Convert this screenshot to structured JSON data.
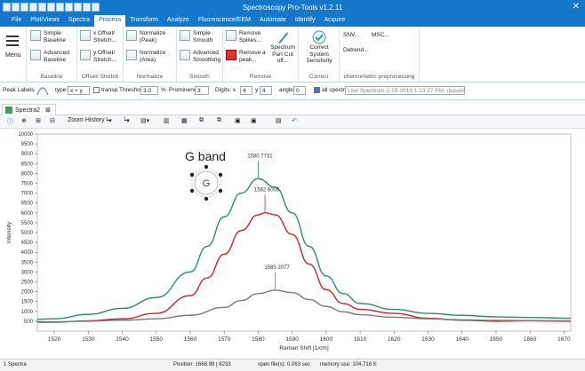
{
  "app": {
    "title": "Spectroscopy Pro-Tools   v1.2.11"
  },
  "menu": [
    "File",
    "Plot/Views",
    "Spectra",
    "Process",
    "Transform",
    "Analyze",
    "Fluorescence/EEM",
    "Automate",
    "Identify",
    "Acquire"
  ],
  "ribbon": {
    "menu_label": "Menu",
    "baseline": {
      "simple": "Simple Baseline",
      "advanced": "Advanced Baseline",
      "label": "Baseline"
    },
    "offset": {
      "x": "x Offset/ Stretch...",
      "y": "y Offset/ Stretch...",
      "label": "Offset/ Stretch"
    },
    "normalize": {
      "peak": "Normalize (Peak)",
      "area": "Normalize (Area)",
      "label": "Normalize"
    },
    "smooth": {
      "simple": "Simple Smooth",
      "advanced": "Advanced Smoothing",
      "label": "Smooth"
    },
    "remove": {
      "spikes": "Remove Spikes...",
      "peak": "Remove a peak...",
      "part": "Spectrum Part Cut off...",
      "label": "Remove"
    },
    "correct": {
      "system": "Correct System Sensitivity",
      "label": "Correct"
    },
    "chemometric": {
      "snv": "SNV...",
      "msc": "MSC...",
      "detrend": "Detrend...",
      "label": "chemometric preprocessing"
    }
  },
  "filterbar": {
    "peak_labels": "Peak Labels",
    "type_label": "type:",
    "type_value": "x + y",
    "transp": "transp.",
    "threshold_label": "Threshold:",
    "threshold_value": "3.0",
    "percent": "%",
    "prominence_label": "Prominence:",
    "prominence_value": "3",
    "digits_label": "Digits: x",
    "digits_x": "4",
    "y_label": "y",
    "digits_y": "4",
    "angle_label": "angle:",
    "angle_value": "0",
    "all_spectra": "all spectra",
    "spectrum_dropdown": "Live Spectrum 2-15-2019 1:13:27 PM, (baselin"
  },
  "tab": {
    "label": "Spectra2"
  },
  "toolbar2": {
    "zoom_history": "Zoom History"
  },
  "statusbar": {
    "spectra": "1 Spectra",
    "position": "Position: 1666.99 | 8233",
    "open": "open file(s): 0.063 sec",
    "memory": "memory use: 104,716 K"
  },
  "chart_data": {
    "type": "line",
    "xlabel": "Raman Shift [1/cm]",
    "ylabel": "Intensity",
    "xlim": [
      1515,
      1672
    ],
    "ylim": [
      0,
      10000
    ],
    "x_ticks": [
      1520,
      1530,
      1540,
      1550,
      1560,
      1570,
      1580,
      1590,
      1600,
      1610,
      1620,
      1630,
      1640,
      1650,
      1660,
      1670
    ],
    "y_ticks": [
      500,
      1000,
      1500,
      2000,
      2500,
      3000,
      3500,
      4000,
      4500,
      5000,
      5500,
      6000,
      6500,
      7000,
      7500,
      8000,
      8500,
      9000,
      9500,
      10000
    ],
    "grid": false,
    "series": [
      {
        "color": "#2e8b6e",
        "points": [
          [
            1515,
            600
          ],
          [
            1520,
            620
          ],
          [
            1530,
            850
          ],
          [
            1540,
            1150
          ],
          [
            1550,
            1700
          ],
          [
            1560,
            3000
          ],
          [
            1565,
            4300
          ],
          [
            1570,
            5800
          ],
          [
            1575,
            7000
          ],
          [
            1580,
            7731
          ],
          [
            1585,
            7300
          ],
          [
            1590,
            6000
          ],
          [
            1595,
            4300
          ],
          [
            1600,
            2800
          ],
          [
            1605,
            1900
          ],
          [
            1610,
            1400
          ],
          [
            1620,
            1100
          ],
          [
            1630,
            900
          ],
          [
            1640,
            800
          ],
          [
            1650,
            720
          ],
          [
            1660,
            690
          ],
          [
            1672,
            650
          ]
        ]
      },
      {
        "color": "#c0282d",
        "points": [
          [
            1515,
            450
          ],
          [
            1520,
            450
          ],
          [
            1530,
            520
          ],
          [
            1540,
            620
          ],
          [
            1550,
            900
          ],
          [
            1560,
            1800
          ],
          [
            1565,
            2700
          ],
          [
            1570,
            3900
          ],
          [
            1575,
            5100
          ],
          [
            1580,
            5900
          ],
          [
            1582,
            6006
          ],
          [
            1585,
            5900
          ],
          [
            1590,
            4900
          ],
          [
            1595,
            3400
          ],
          [
            1600,
            2100
          ],
          [
            1605,
            1400
          ],
          [
            1610,
            1100
          ],
          [
            1620,
            900
          ],
          [
            1630,
            650
          ],
          [
            1640,
            550
          ],
          [
            1650,
            500
          ],
          [
            1660,
            520
          ],
          [
            1672,
            500
          ]
        ]
      },
      {
        "color": "#7a7a7a",
        "points": [
          [
            1515,
            480
          ],
          [
            1520,
            470
          ],
          [
            1530,
            500
          ],
          [
            1540,
            550
          ],
          [
            1550,
            620
          ],
          [
            1560,
            800
          ],
          [
            1570,
            1200
          ],
          [
            1575,
            1550
          ],
          [
            1580,
            1900
          ],
          [
            1585,
            2077
          ],
          [
            1590,
            1950
          ],
          [
            1595,
            1600
          ],
          [
            1600,
            1250
          ],
          [
            1605,
            980
          ],
          [
            1610,
            830
          ],
          [
            1620,
            700
          ],
          [
            1630,
            620
          ],
          [
            1640,
            570
          ],
          [
            1650,
            540
          ],
          [
            1660,
            530
          ],
          [
            1672,
            520
          ]
        ]
      }
    ],
    "peak_labels": [
      {
        "x": 1580,
        "y": 7731,
        "text": "1580  7731"
      },
      {
        "x": 1582,
        "y": 6006,
        "text": "1582  6006"
      },
      {
        "x": 1585,
        "y": 2077,
        "text": "1585  2077"
      }
    ],
    "annotation": {
      "title": "G band",
      "letter": "G"
    }
  }
}
